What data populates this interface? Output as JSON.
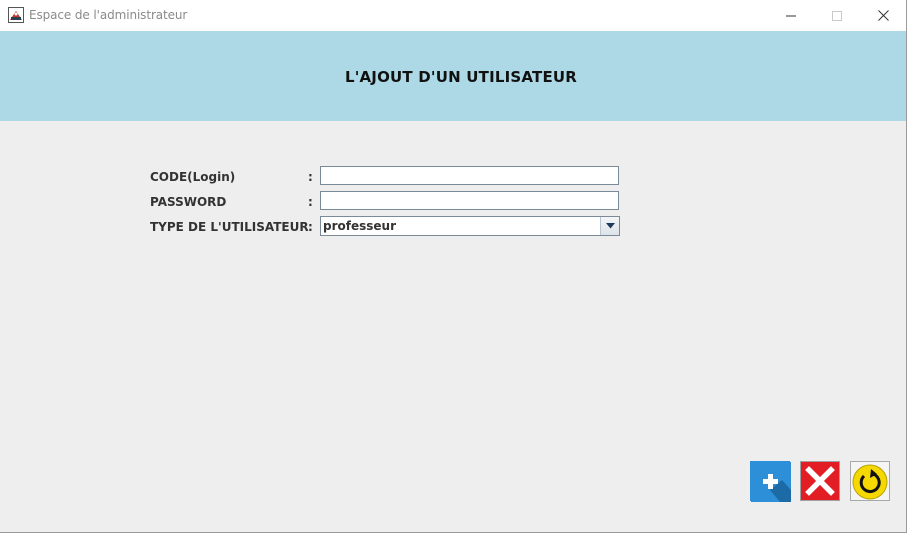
{
  "window": {
    "title": "Espace de l'administrateur"
  },
  "header": {
    "title": "L'AJOUT D'UN UTILISATEUR"
  },
  "form": {
    "login": {
      "label": "CODE(Login)",
      "separator": ":",
      "value": ""
    },
    "password": {
      "label": "PASSWORD",
      "separator": ":",
      "value": ""
    },
    "user_type": {
      "label": "TYPE DE L'UTILISATEUR",
      "separator": ":",
      "selected": "professeur"
    }
  },
  "actions": {
    "add": {
      "icon": "plus-icon",
      "color": "#2d8fd7"
    },
    "delete": {
      "icon": "x-icon",
      "color": "#e31d24"
    },
    "refresh": {
      "icon": "refresh-icon",
      "color": "#f5d800"
    }
  },
  "colors": {
    "banner": "#add8e6",
    "background": "#eeeeee"
  }
}
